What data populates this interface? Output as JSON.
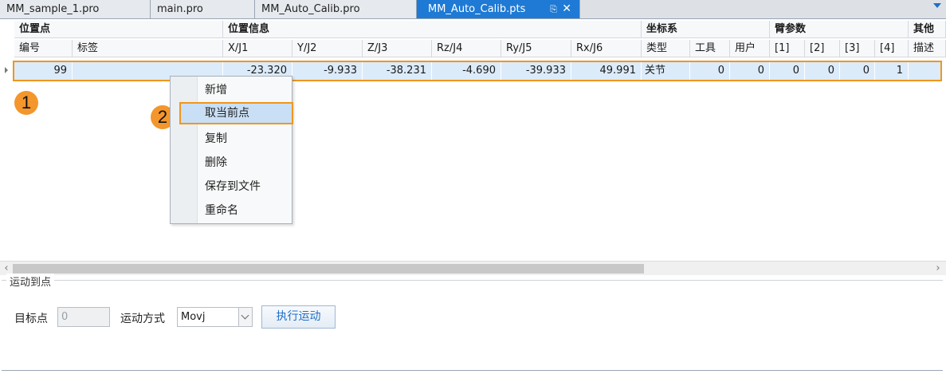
{
  "tabs": [
    {
      "label": "MM_sample_1.pro"
    },
    {
      "label": "main.pro"
    },
    {
      "label": "MM_Auto_Calib.pro"
    },
    {
      "label": "MM_Auto_Calib.pts",
      "active": true,
      "pin_icon": "pin-icon",
      "close_icon": "close-icon"
    }
  ],
  "grid": {
    "groups": [
      "位置点",
      "位置信息",
      "坐标系",
      "臂参数",
      "其他"
    ],
    "columns": [
      "编号",
      "标签",
      "X/J1",
      "Y/J2",
      "Z/J3",
      "Rz/J4",
      "Ry/J5",
      "Rx/J6",
      "类型",
      "工具",
      "用户",
      "[1]",
      "[2]",
      "[3]",
      "[4]",
      "描述"
    ],
    "row": [
      "99",
      "",
      "-23.320",
      "-9.933",
      "-38.231",
      "-4.690",
      "-39.933",
      "49.991",
      "关节",
      "0",
      "0",
      "0",
      "0",
      "0",
      "1",
      ""
    ]
  },
  "badges": [
    "1",
    "2"
  ],
  "context_menu": {
    "items": [
      "新增",
      "取当前点",
      "复制",
      "删除",
      "保存到文件",
      "重命名"
    ],
    "hovered_index": 1
  },
  "motion_group": {
    "title": "运动到点",
    "target_label": "目标点",
    "target_value": "0",
    "mode_label": "运动方式",
    "mode_value": "Movj",
    "execute_label": "执行运动"
  },
  "colors": {
    "accent": "#1e7ad4",
    "highlight": "#f0961e",
    "badge": "#f3962c",
    "selected_row": "#dcebfa"
  }
}
